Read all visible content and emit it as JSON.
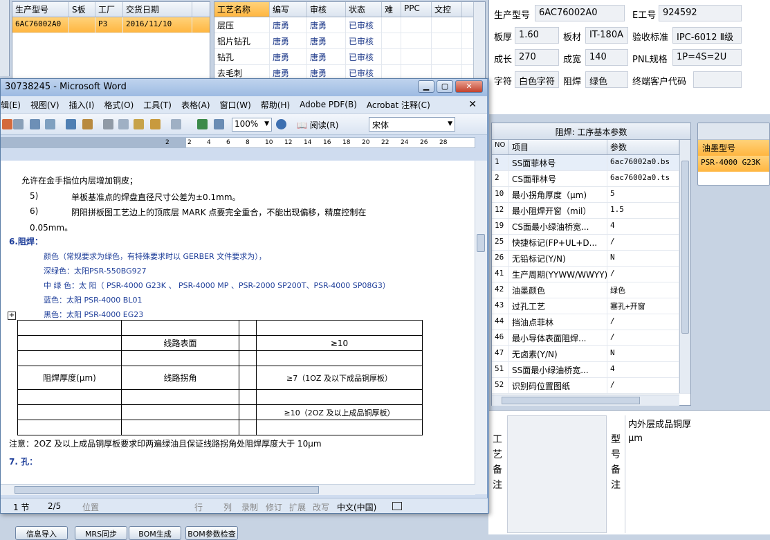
{
  "order_grid": {
    "headers": [
      "生产型号",
      "S板",
      "工厂",
      "交货日期"
    ],
    "row": [
      "6AC76002A0",
      "",
      "P3",
      "2016/11/10"
    ]
  },
  "process_grid": {
    "headers": [
      "工艺名称",
      "编写",
      "审核",
      "状态",
      "难",
      "PPC",
      "文控"
    ],
    "rows": [
      [
        "层压",
        "唐勇",
        "唐勇",
        "已审核"
      ],
      [
        "铝片钻孔",
        "唐勇",
        "唐勇",
        "已审核"
      ],
      [
        "钻孔",
        "唐勇",
        "唐勇",
        "已审核"
      ],
      [
        "去毛刺",
        "唐勇",
        "唐勇",
        "已审核"
      ]
    ]
  },
  "info": {
    "model_label": "生产型号",
    "model": "6AC76002A0",
    "eno_label": "E工号",
    "eno": "924592",
    "thickness_label": "板厚",
    "thickness": "1.60",
    "material_label": "板材",
    "material": "IT-180A",
    "std_label": "验收标准",
    "std": "IPC-6012 Ⅱ级",
    "length_label": "成长",
    "length": "270",
    "width_label": "成宽",
    "width": "140",
    "pnl_label": "PNL规格",
    "pnl": "1P=4S=2U",
    "legend_label": "字符",
    "legend": "白色字符",
    "mask_label": "阻焊",
    "mask": "绿色",
    "cust_label": "终端客户代码",
    "cust": ""
  },
  "params": {
    "title": "阻焊: 工序基本参数",
    "headers": [
      "NO",
      "项目",
      "参数"
    ],
    "rows": [
      [
        "1",
        "SS面菲林号",
        "6ac76002a0.bs"
      ],
      [
        "2",
        "CS面菲林号",
        "6ac76002a0.ts"
      ],
      [
        "10",
        "最小拐角厚度（μm)",
        "5"
      ],
      [
        "12",
        "最小阻焊开窗（mil）",
        "1.5"
      ],
      [
        "19",
        "CS面最小绿油桥宽...",
        "4"
      ],
      [
        "25",
        "快捷标记(FP+UL+D...",
        "/"
      ],
      [
        "26",
        "无铅标记(Y/N)",
        "N"
      ],
      [
        "41",
        "生产周期(YYWW/WWYY)",
        "/"
      ],
      [
        "42",
        "油墨颜色",
        "绿色"
      ],
      [
        "43",
        "过孔工艺",
        "塞孔+开窗"
      ],
      [
        "44",
        "挡油点菲林",
        "/"
      ],
      [
        "46",
        "最小导体表面阻焊...",
        "/"
      ],
      [
        "47",
        "无卤素(Y/N)",
        "N"
      ],
      [
        "51",
        "SS面最小绿油桥宽...",
        "4"
      ],
      [
        "52",
        "识别码位置图纸",
        "/"
      ]
    ]
  },
  "ink": {
    "header": "油墨型号",
    "value": "PSR-4000 G23K"
  },
  "notes": {
    "craft_label": "工艺备注",
    "model_label": "型号备注",
    "model_text": "内外层成品铜厚 μm"
  },
  "bottom_buttons": [
    "信息导入",
    "MRS同步",
    "BOM生成",
    "BOM参数检查"
  ],
  "word": {
    "title": "30738245 - Microsoft Word",
    "menu": [
      "辑(E)",
      "视图(V)",
      "插入(I)",
      "格式(O)",
      "工具(T)",
      "表格(A)",
      "窗口(W)",
      "帮助(H)",
      "Adobe PDF(B)",
      "Acrobat 注释(C)"
    ],
    "zoom": "100%",
    "read": "阅读(R)",
    "font": "宋体",
    "ruler": [
      "2",
      "2",
      "4",
      "6",
      "8",
      "10",
      "12",
      "14",
      "16",
      "18",
      "20",
      "22",
      "24",
      "26",
      "28"
    ],
    "lines": {
      "l1": "允许在金手指位内层增加铜皮；",
      "l2n": "5)",
      "l2": "单板基准点的焊盘直径尺寸公差为±0.1mm。",
      "l3n": "6)",
      "l3": "阴阳拼板图工艺边上的顶底层 MARK  点要完全重合，不能出现偏移，精度控制在",
      "l4": "0.05mm。",
      "h6": "6.阻焊：",
      "c1": "颜色（常规要求为绿色，有特殊要求时以 GERBER 文件要求为），",
      "c2": "深绿色：太阳PSR-550BG927",
      "c3": "中 绿 色：太 阳（ PSR-4000  G23K 、 PSR-4000  MP 、PSR-2000 SP200T、PSR-4000 SP08G3）",
      "c4": "蓝色：太阳 PSR-4000 BL01",
      "c5": "黑色：太阳 PSR-4000 EG23",
      "t1": "线路表面",
      "t2": "≥10",
      "t3": "阻焊厚度(μm)",
      "t4": "线路拐角",
      "t5": "≥7（1OZ 及以下成品铜厚板）",
      "t6": "≥10（2OZ 及以上成品铜厚板）",
      "note": "注意：2OZ 及以上成品铜厚板要求印两遍绿油且保证线路拐角处阻焊厚度大于  10μm",
      "h7": "7. 孔："
    },
    "status": {
      "sec": "1 节",
      "page": "2/5",
      "pos": "位置",
      "row": "行",
      "col": "列",
      "rec": "录制",
      "rev": "修订",
      "ext": "扩展",
      "ovr": "改写",
      "lang": "中文(中国)"
    }
  }
}
